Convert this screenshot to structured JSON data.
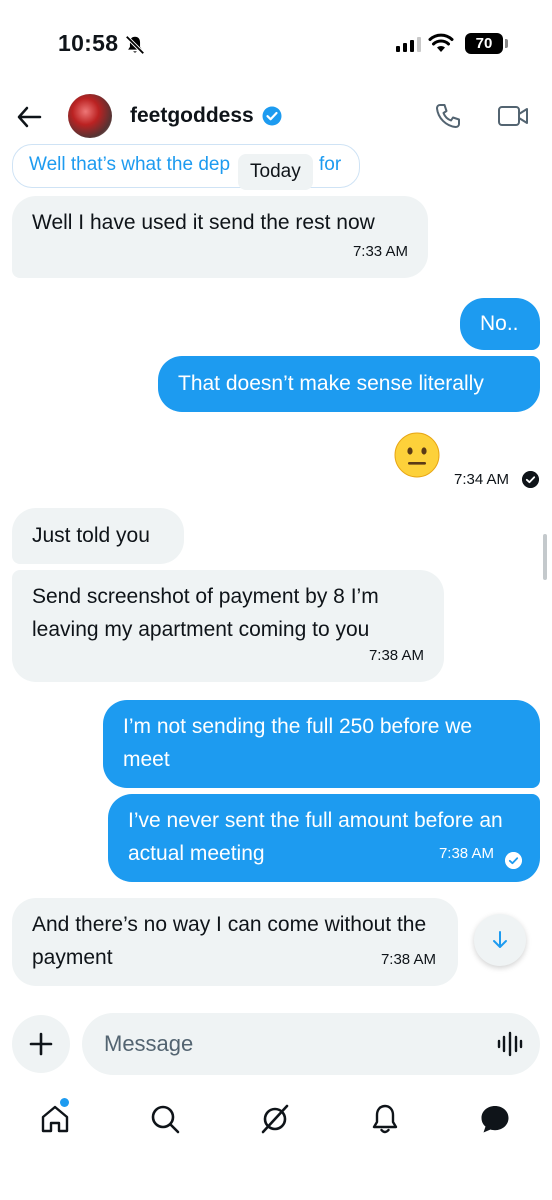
{
  "status_bar": {
    "time": "10:58",
    "battery": "70"
  },
  "header": {
    "username": "feetgoddess"
  },
  "quoted": {
    "text": "Well that’s what the dep",
    "text_after": "for"
  },
  "date_divider": "Today",
  "messages": [
    {
      "side": "in",
      "text": "Well I have used it send the rest now",
      "time": "7:33 AM"
    },
    {
      "side": "out",
      "text": "No.."
    },
    {
      "side": "out",
      "text": "That doesn’t make sense literally"
    },
    {
      "side": "out",
      "text": "😐",
      "time": "7:34 AM"
    },
    {
      "side": "in",
      "text": "Just told you"
    },
    {
      "side": "in",
      "text": "Send screenshot of payment by 8 I’m leaving my apartment coming to you",
      "time": "7:38 AM"
    },
    {
      "side": "out",
      "text": "I’m not sending the full 250 before we meet"
    },
    {
      "side": "out",
      "text": "I’ve never sent the full amount before an actual meeting",
      "time": "7:38 AM"
    },
    {
      "side": "in",
      "text": "And there’s no way I can come without the payment",
      "time": "7:38 AM"
    }
  ],
  "composer": {
    "placeholder": "Message"
  },
  "nav": [
    "home-icon",
    "search-icon",
    "grok-icon",
    "notifications-icon",
    "messages-icon"
  ],
  "colors": {
    "accent": "#1d9bf0",
    "incoming_bubble": "#eff3f4",
    "text": "#0f1419"
  }
}
